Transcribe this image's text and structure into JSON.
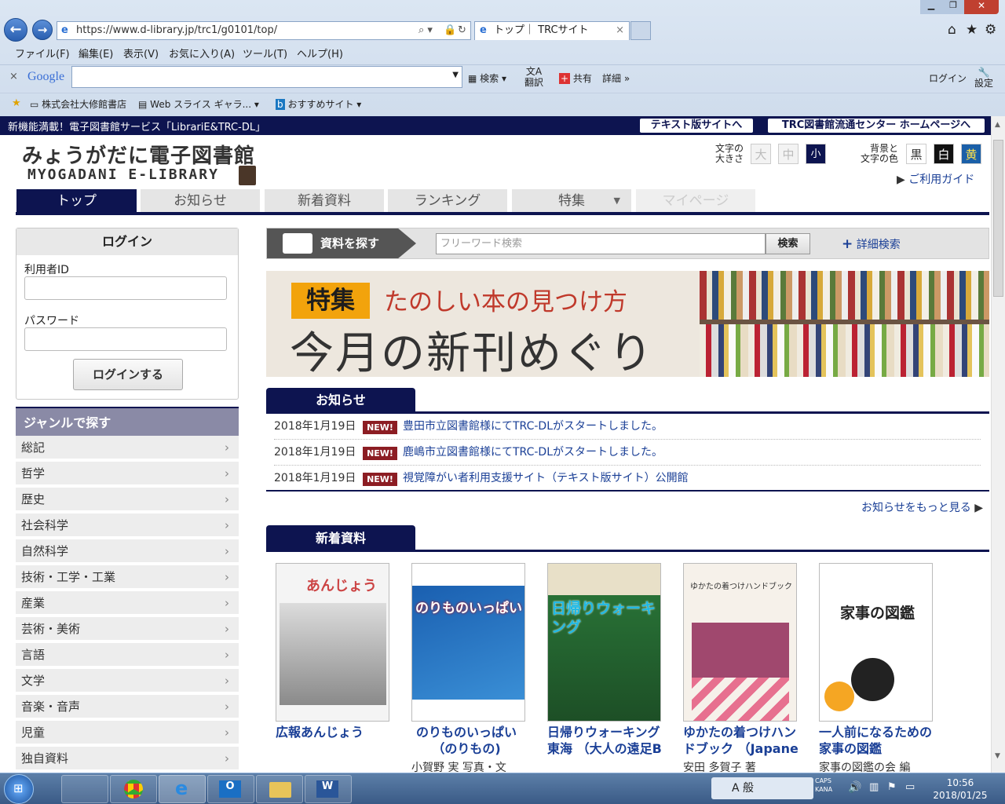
{
  "browser": {
    "url": "https://www.d-library.jp/trc1/g0101/top/",
    "tab_title": "トップ｜ TRCサイト",
    "menu": [
      "ファイル(F)",
      "編集(E)",
      "表示(V)",
      "お気に入り(A)",
      "ツール(T)",
      "ヘルプ(H)"
    ],
    "google": {
      "brand": "Google",
      "search": "検索",
      "translate": "翻訳",
      "share": "共有",
      "more": "詳細",
      "login": "ログイン",
      "settings": "設定"
    },
    "favorites": [
      "株式会社大修館書店",
      "Web スライス ギャラ...",
      "おすすめサイト"
    ]
  },
  "strip": {
    "announcement": "新機能満載！電子図書館サービス「LibrariE&TRC-DL」",
    "text_site": "テキスト版サイトへ",
    "trc_home": "TRC図書館流通センター ホームページへ"
  },
  "header": {
    "logo_jp": "みょうがだに電子図書館",
    "logo_en": "MYOGADANI E-LIBRARY",
    "font_size_label": "文字の\n大きさ",
    "sizes": [
      "大",
      "中",
      "小"
    ],
    "color_label": "背景と\n文字の色",
    "colors": [
      "黒",
      "白",
      "黄"
    ],
    "guide": "ご利用ガイド"
  },
  "nav": [
    "トップ",
    "お知らせ",
    "新着資料",
    "ランキング",
    "特集",
    "マイページ"
  ],
  "login": {
    "title": "ログイン",
    "user_id": "利用者ID",
    "password": "パスワード",
    "button": "ログインする"
  },
  "genre": {
    "title": "ジャンルで探す",
    "items": [
      "総記",
      "哲学",
      "歴史",
      "社会科学",
      "自然科学",
      "技術・工学・工業",
      "産業",
      "芸術・美術",
      "言語",
      "文学",
      "音楽・音声",
      "児童",
      "独自資料"
    ]
  },
  "search": {
    "label": "資料を探す",
    "placeholder": "フリーワード検索",
    "button": "検索",
    "advanced": "詳細検索"
  },
  "banner": {
    "badge": "特集",
    "subtitle": "たのしい本の見つけ方",
    "title": "今月の新刊めぐり"
  },
  "news": {
    "title": "お知らせ",
    "new": "NEW!",
    "items": [
      {
        "date": "2018年1月19日",
        "text": "豊田市立図書館様にてTRC-DLがスタートしました。"
      },
      {
        "date": "2018年1月19日",
        "text": "鹿嶋市立図書館様にてTRC-DLがスタートしました。"
      },
      {
        "date": "2018年1月19日",
        "text": "視覚障がい者利用支援サイト（テキスト版サイト）公開館"
      }
    ],
    "more": "お知らせをもっと見る"
  },
  "new_materials": {
    "title": "新着資料",
    "books": [
      {
        "title": "広報あんじょう",
        "author": "",
        "cover": "あんじょう"
      },
      {
        "title": "のりものいっぱい（のりもの)",
        "author": "小賀野 実 写真・文",
        "cover": "のりものいっぱい"
      },
      {
        "title": "日帰りウォーキング東海 （大人の遠足B",
        "author": "",
        "cover": "日帰りウォーキング"
      },
      {
        "title": "ゆかたの着つけハンドブック （Japane",
        "author": "安田 多賀子 著",
        "cover": "ゆかたの着つけハンドブック"
      },
      {
        "title": "一人前になるための家事の図鑑",
        "author": "家事の図鑑の会 編",
        "cover": "家事の図鑑"
      }
    ]
  },
  "taskbar": {
    "time": "10:56",
    "date": "2018/01/25",
    "ime": "A 般",
    "caps": "CAPS",
    "kana": "KANA"
  }
}
